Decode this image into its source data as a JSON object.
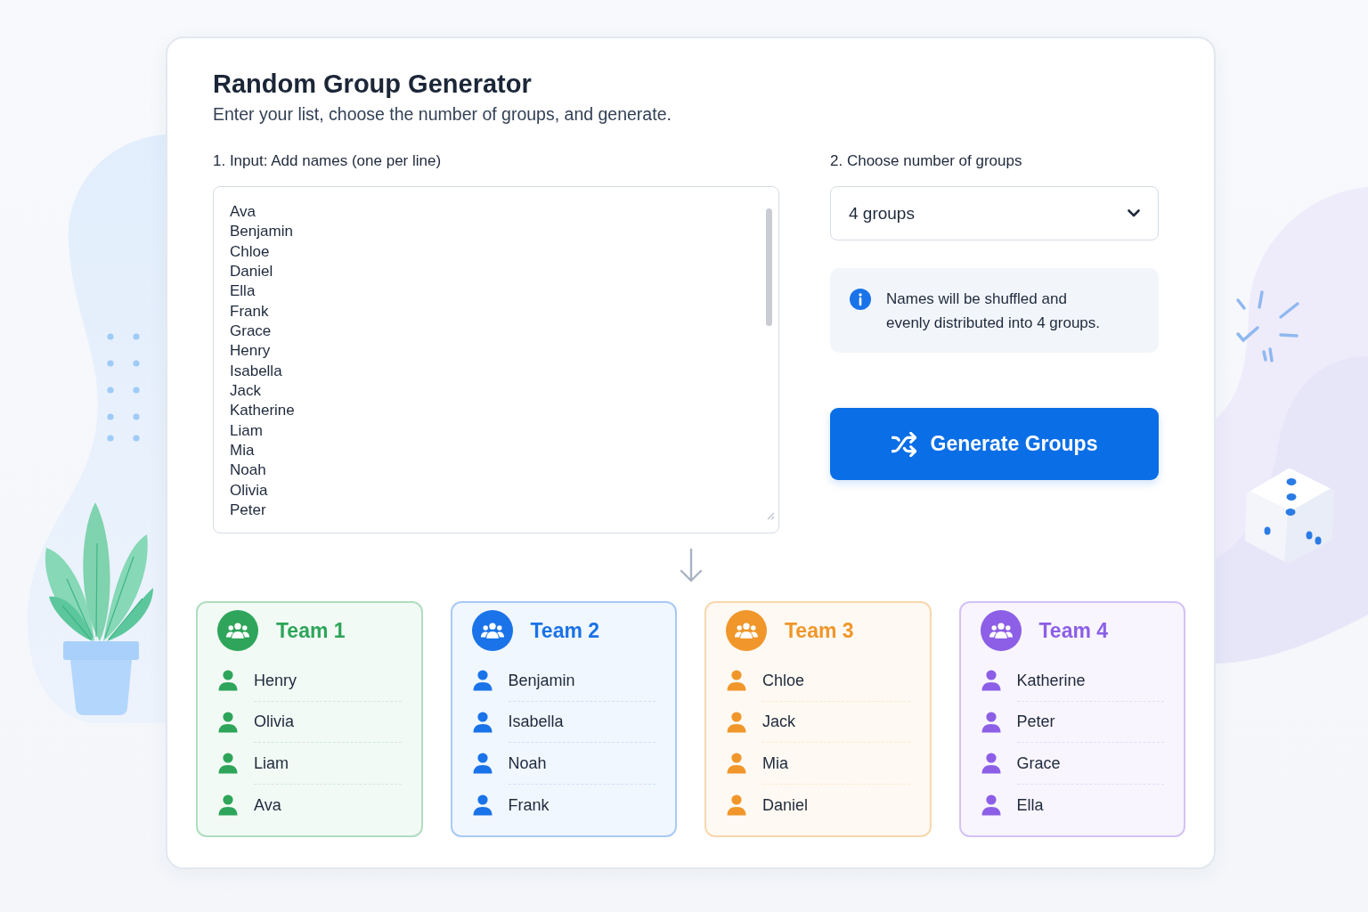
{
  "header": {
    "title": "Random Group Generator",
    "subtitle": "Enter your list, choose the number of groups, and generate."
  },
  "names_input": {
    "label": "1. Input: Add names (one per line)",
    "value": [
      "Ava",
      "Benjamin",
      "Chloe",
      "Daniel",
      "Ella",
      "Frank",
      "Grace",
      "Henry",
      "Isabella",
      "Jack",
      "Katherine",
      "Liam",
      "Mia",
      "Noah",
      "Olivia",
      "Peter"
    ]
  },
  "group_count": {
    "label": "2. Choose number of groups",
    "value": "4 groups"
  },
  "info": {
    "text": "Names will be shuffled and evenly distributed into 4 groups."
  },
  "generate_button": {
    "label": "Generate Groups"
  },
  "teams": [
    {
      "name": "Team 1",
      "color": "#2ea55a",
      "members": [
        "Henry",
        "Olivia",
        "Liam",
        "Ava"
      ]
    },
    {
      "name": "Team 2",
      "color": "#1a73e8",
      "members": [
        "Benjamin",
        "Isabella",
        "Noah",
        "Frank"
      ]
    },
    {
      "name": "Team 3",
      "color": "#f0962a",
      "members": [
        "Chloe",
        "Jack",
        "Mia",
        "Daniel"
      ]
    },
    {
      "name": "Team 4",
      "color": "#8c5fe6",
      "members": [
        "Katherine",
        "Peter",
        "Grace",
        "Ella"
      ]
    }
  ]
}
